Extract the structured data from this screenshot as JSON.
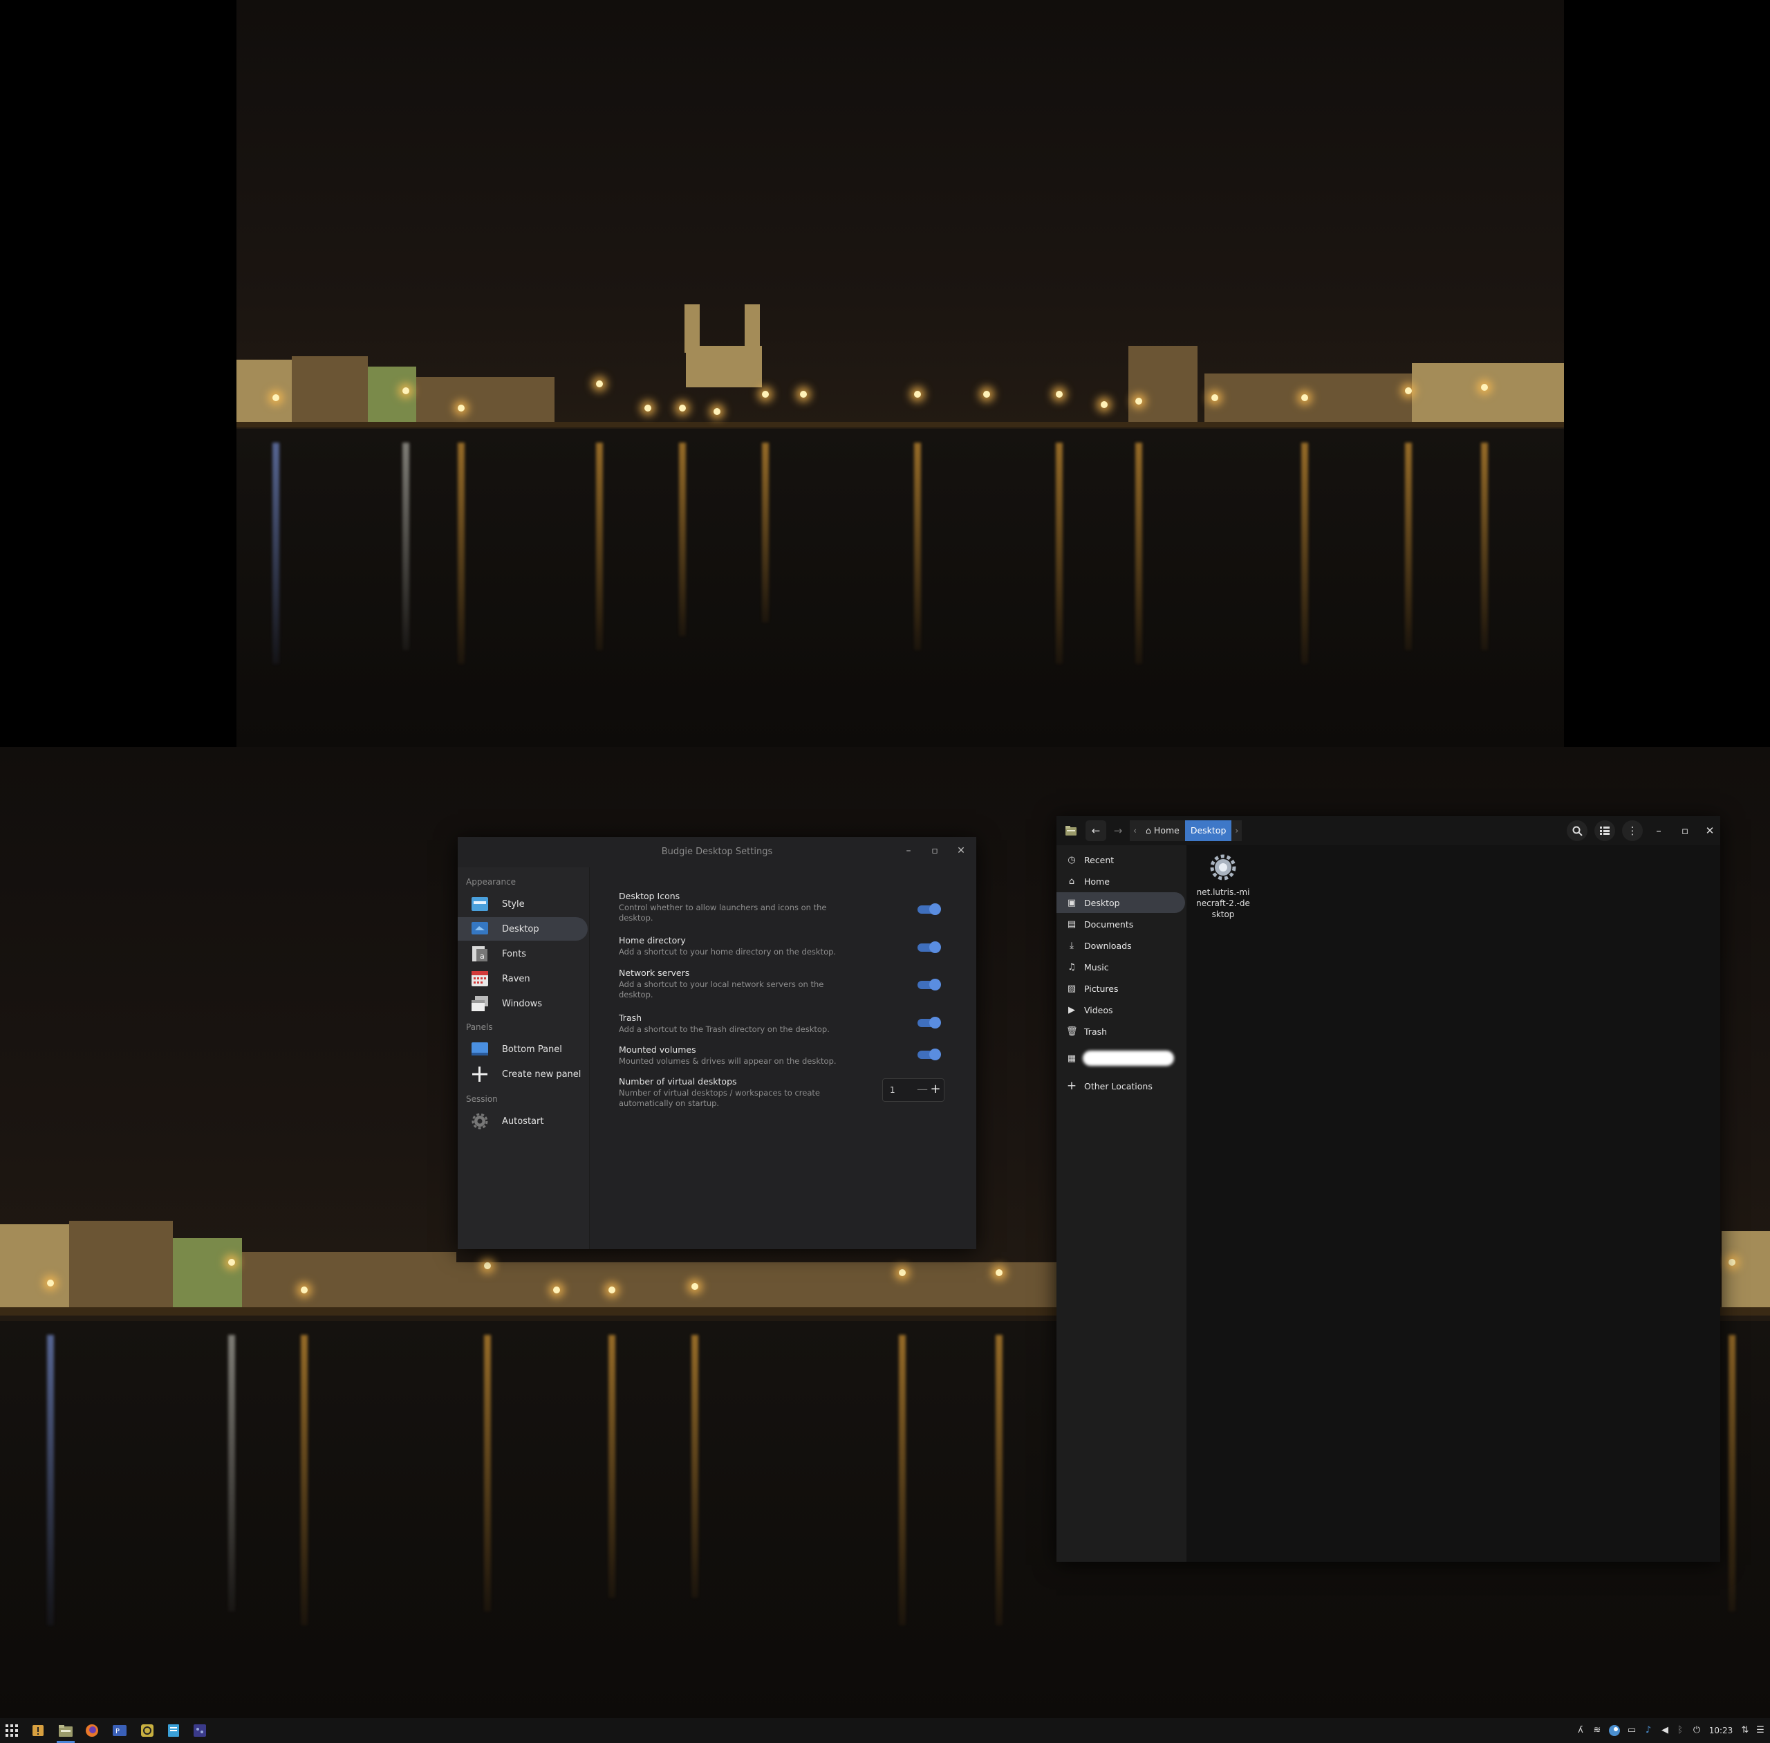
{
  "colors": {
    "accent": "#3e78c8",
    "toggle_on": "#5a8de0",
    "panel": "#141414"
  },
  "settings_window": {
    "title": "Budgie Desktop Settings",
    "controls": {
      "minimize": "–",
      "maximize": "▫",
      "close": "✕"
    },
    "sidebar": {
      "sections": [
        {
          "label": "Appearance",
          "items": [
            {
              "label": "Style",
              "icon": "style-icon"
            },
            {
              "label": "Desktop",
              "icon": "desktop-icon",
              "selected": true
            },
            {
              "label": "Fonts",
              "icon": "fonts-icon"
            },
            {
              "label": "Raven",
              "icon": "raven-calendar-icon"
            },
            {
              "label": "Windows",
              "icon": "windows-icon"
            }
          ]
        },
        {
          "label": "Panels",
          "items": [
            {
              "label": "Bottom Panel",
              "icon": "panel-icon"
            },
            {
              "label": "Create new panel",
              "icon": "plus-icon"
            }
          ]
        },
        {
          "label": "Session",
          "items": [
            {
              "label": "Autostart",
              "icon": "gear-icon"
            }
          ]
        }
      ]
    },
    "options": [
      {
        "title": "Desktop Icons",
        "desc": "Control whether to allow launchers and icons on the desktop.",
        "enabled": true
      },
      {
        "title": "Home directory",
        "desc": "Add a shortcut to your home directory on the desktop.",
        "enabled": true
      },
      {
        "title": "Network servers",
        "desc": "Add a shortcut to your local network servers on the desktop.",
        "enabled": true
      },
      {
        "title": "Trash",
        "desc": "Add a shortcut to the Trash directory on the desktop.",
        "enabled": true
      },
      {
        "title": "Mounted volumes",
        "desc": "Mounted volumes & drives will appear on the desktop.",
        "enabled": true
      }
    ],
    "virtual_desktops": {
      "title": "Number of virtual desktops",
      "desc": "Number of virtual desktops / workspaces to create automatically on startup.",
      "value": "1",
      "minus": "—",
      "plus": "+"
    }
  },
  "files_window": {
    "nav": {
      "back": "←",
      "forward": "→",
      "left": "‹",
      "right": "›"
    },
    "path": {
      "home": "Home",
      "current": "Desktop"
    },
    "controls": {
      "search": "search-icon",
      "view": "list-view-icon",
      "menu": "⋮",
      "minimize": "–",
      "maximize": "▫",
      "close": "✕"
    },
    "places": [
      {
        "label": "Recent",
        "icon": "◷"
      },
      {
        "label": "Home",
        "icon": "⌂"
      },
      {
        "label": "Desktop",
        "icon": "▣",
        "selected": true
      },
      {
        "label": "Documents",
        "icon": "▤"
      },
      {
        "label": "Downloads",
        "icon": "⤓"
      },
      {
        "label": "Music",
        "icon": "♫"
      },
      {
        "label": "Pictures",
        "icon": "▨"
      },
      {
        "label": "Videos",
        "icon": "▶"
      },
      {
        "label": "Trash",
        "icon": "🗑"
      }
    ],
    "other_locations": {
      "label": "Other Locations",
      "icon": "+"
    },
    "files": [
      {
        "name": "net.lutris.-minecraft-2.-desktop",
        "icon": "gear-file-icon"
      }
    ]
  },
  "taskbar": {
    "apps": [
      "app-grid-icon",
      "warning-app-icon",
      "files-app-icon",
      "firefox-icon",
      "terminal-app-icon",
      "settings-app-icon",
      "text-editor-icon",
      "game-app-icon"
    ],
    "clock": "10:23",
    "tray_icons": [
      "text-icon",
      "network-icon",
      "steam-icon",
      "screen-icon",
      "bell-icon",
      "volume-icon",
      "bluetooth-icon",
      "power-icon",
      "keyboard-icon"
    ]
  }
}
